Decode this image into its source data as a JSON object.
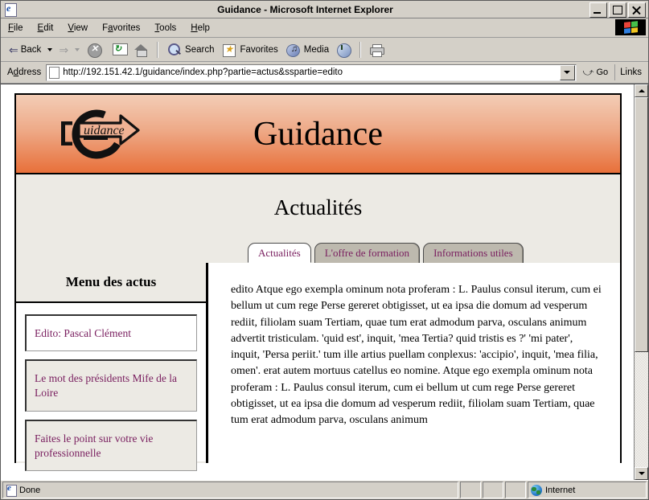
{
  "window": {
    "title": "Guidance - Microsoft Internet Explorer",
    "icon": "ie-document-icon",
    "minimize_label": "Minimize",
    "maximize_label": "Maximize",
    "close_label": "Close"
  },
  "menubar": {
    "items": [
      {
        "label": "File",
        "accel": "F",
        "rest": "ile"
      },
      {
        "label": "Edit",
        "accel": "E",
        "rest": "dit"
      },
      {
        "label": "View",
        "accel": "V",
        "rest": "iew"
      },
      {
        "label": "Favorites",
        "pre": "F",
        "accel": "a",
        "rest": "vorites"
      },
      {
        "label": "Tools",
        "accel": "T",
        "rest": "ools"
      },
      {
        "label": "Help",
        "accel": "H",
        "rest": "elp"
      }
    ]
  },
  "toolbar": {
    "back_label": "Back",
    "forward_label": "",
    "stop_label": "",
    "refresh_label": "",
    "home_label": "",
    "search_label": "Search",
    "favorites_label": "Favorites",
    "media_label": "Media",
    "history_label": "",
    "print_label": ""
  },
  "addressbar": {
    "label": "Address",
    "url": "http://192.151.42.1/guidance/index.php?partie=actus&sspartie=edito",
    "go_label": "Go",
    "links_label": "Links"
  },
  "page": {
    "brand": "Guidance",
    "logo_text": "uidance",
    "subtitle": "Actualités",
    "tabs": [
      {
        "label": "Actualités",
        "active": true
      },
      {
        "label": "L'offre de formation",
        "active": false
      },
      {
        "label": "Informations utiles",
        "active": false
      }
    ],
    "sidebar": {
      "heading": "Menu des actus",
      "items": [
        {
          "label": "Edito: Pascal Clément",
          "selected": true
        },
        {
          "label": "Le mot des présidents Mife de la Loire",
          "selected": false
        },
        {
          "label": "Faites le point sur votre vie professionnelle",
          "selected": false
        }
      ]
    },
    "article": {
      "body": "edito Atque ego exempla ominum nota proferam : L. Paulus consul iterum, cum ei bellum ut cum rege Perse gereret obtigisset, ut ea ipsa die domum ad vesperum rediit, filiolam suam Tertiam, quae tum erat admodum parva, osculans animum advertit tristiculam. 'quid est', inquit, 'mea Tertia? quid tristis es ?' 'mi pater', inquit, 'Persa periit.' tum ille artius puellam conplexus: 'accipio', inquit, 'mea filia, omen'. erat autem mortuus catellus eo nomine. Atque ego exempla ominum nota proferam : L. Paulus consul iterum, cum ei bellum ut cum rege Perse gereret obtigisset, ut ea ipsa die domum ad vesperum rediit, filiolam suam Tertiam, quae tum erat admodum parva, osculans animum"
    },
    "colors": {
      "banner_top": "#f3cdb6",
      "banner_bottom": "#e8703a",
      "link_purple": "#7a2060",
      "page_bg": "#eceae4"
    }
  },
  "statusbar": {
    "status": "Done",
    "zone": "Internet"
  }
}
